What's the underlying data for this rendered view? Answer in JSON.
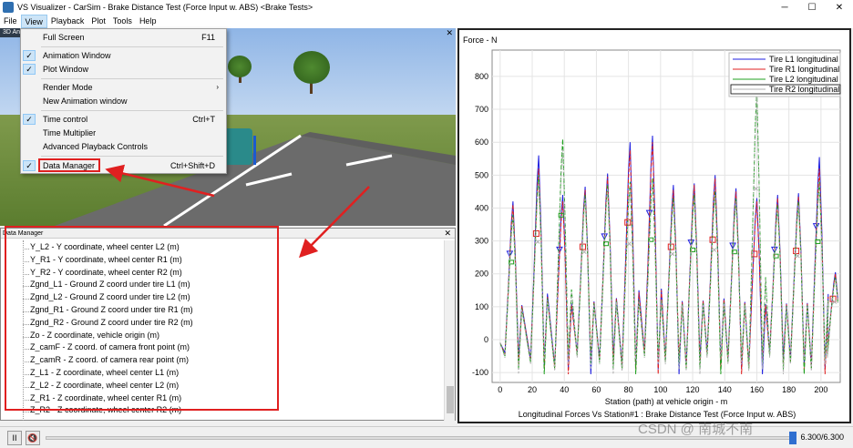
{
  "window": {
    "title": "VS Visualizer - CarSim - Brake Distance Test (Force Input w. ABS) <Brake Tests>",
    "minimize": "─",
    "maximize": "☐",
    "close": "✕"
  },
  "menubar": [
    "File",
    "View",
    "Playback",
    "Plot",
    "Tools",
    "Help"
  ],
  "view_menu": {
    "items": [
      {
        "label": "Full Screen",
        "shortcut": "F11",
        "checked": false
      },
      {
        "label": "Animation Window",
        "shortcut": "",
        "checked": true
      },
      {
        "label": "Plot Window",
        "shortcut": "",
        "checked": true
      },
      {
        "label": "Render Mode",
        "shortcut": "›",
        "checked": false
      },
      {
        "label": "New Animation window",
        "shortcut": "",
        "checked": false
      },
      {
        "label": "Time control",
        "shortcut": "Ctrl+T",
        "checked": true
      },
      {
        "label": "Time Multiplier",
        "shortcut": "",
        "checked": false
      },
      {
        "label": "Advanced Playback Controls",
        "shortcut": "",
        "checked": false
      },
      {
        "label": "Data Manager",
        "shortcut": "Ctrl+Shift+D",
        "checked": true
      }
    ],
    "check_glyph": "✓"
  },
  "anim_panel": {
    "title": "3D An",
    "close": "✕"
  },
  "data_manager": {
    "title": "Data Manager",
    "close": "✕",
    "rows": [
      "Y_L2 - Y coordinate, wheel center L2 (m)",
      "Y_R1 - Y coordinate, wheel center R1 (m)",
      "Y_R2 - Y coordinate, wheel center R2 (m)",
      "Zgnd_L1 - Ground Z coord under tire L1 (m)",
      "Zgnd_L2 - Ground Z coord under tire L2 (m)",
      "Zgnd_R1 - Ground Z coord under tire R1 (m)",
      "Zgnd_R2 - Ground Z coord under tire R2 (m)",
      "Zo - Z coordinate, vehicle origin (m)",
      "Z_camF - Z coord. of camera front point (m)",
      "Z_camR - Z coord. of camera rear point (m)",
      "Z_L1 - Z coordinate, wheel center L1 (m)",
      "Z_L2 - Z coordinate, wheel center L2 (m)",
      "Z_R1 - Z coordinate, wheel center R1 (m)",
      "Z_R2 - Z coordinate, wheel center R2 (m)"
    ]
  },
  "chart_data": {
    "type": "line",
    "ylabel": "Force - N",
    "xlabel": "Station (path) at vehicle origin - m",
    "title": "Longitudinal Forces Vs Station#1 : Brake Distance Test (Force Input w. ABS)",
    "xlim": [
      -5,
      212
    ],
    "ylim": [
      -130,
      880
    ],
    "xticks": [
      0,
      20,
      40,
      60,
      80,
      100,
      120,
      140,
      160,
      180,
      200
    ],
    "yticks": [
      -100,
      0,
      100,
      200,
      300,
      400,
      500,
      600,
      700,
      800
    ],
    "grid": true,
    "legend_position": "top-right",
    "peaks_x": [
      8,
      24,
      39,
      53,
      67,
      81,
      95,
      108,
      121,
      134,
      147,
      160,
      173,
      186,
      199,
      209
    ],
    "series": [
      {
        "name": "Tire L1 longitudinal",
        "color": "#1f1fe0",
        "marker": "triangle",
        "peaks": [
          420,
          560,
          440,
          465,
          505,
          600,
          620,
          470,
          475,
          500,
          460,
          430,
          440,
          445,
          555,
          205
        ]
      },
      {
        "name": "Tire R1 longitudinal",
        "color": "#e02020",
        "marker": "square",
        "peaks": [
          410,
          520,
          420,
          455,
          495,
          575,
          600,
          455,
          470,
          490,
          450,
          420,
          430,
          435,
          520,
          200
        ]
      },
      {
        "name": "Tire L2 longitudinal",
        "color": "#20a020",
        "marker": "circle",
        "peaks": [
          380,
          500,
          610,
          440,
          470,
          480,
          490,
          430,
          440,
          450,
          430,
          760,
          410,
          420,
          480,
          190
        ]
      },
      {
        "name": "Tire R2 longitudinal",
        "color": "#b0b0b0",
        "marker": "x",
        "peaks": [
          370,
          480,
          580,
          430,
          460,
          470,
          480,
          420,
          430,
          440,
          420,
          740,
          400,
          410,
          470,
          185
        ]
      }
    ]
  },
  "playback": {
    "pause": "II",
    "mute": "🔇",
    "time": "6.300/6.300",
    "progress": 1.0
  },
  "watermark": "CSDN @ 南城不南"
}
